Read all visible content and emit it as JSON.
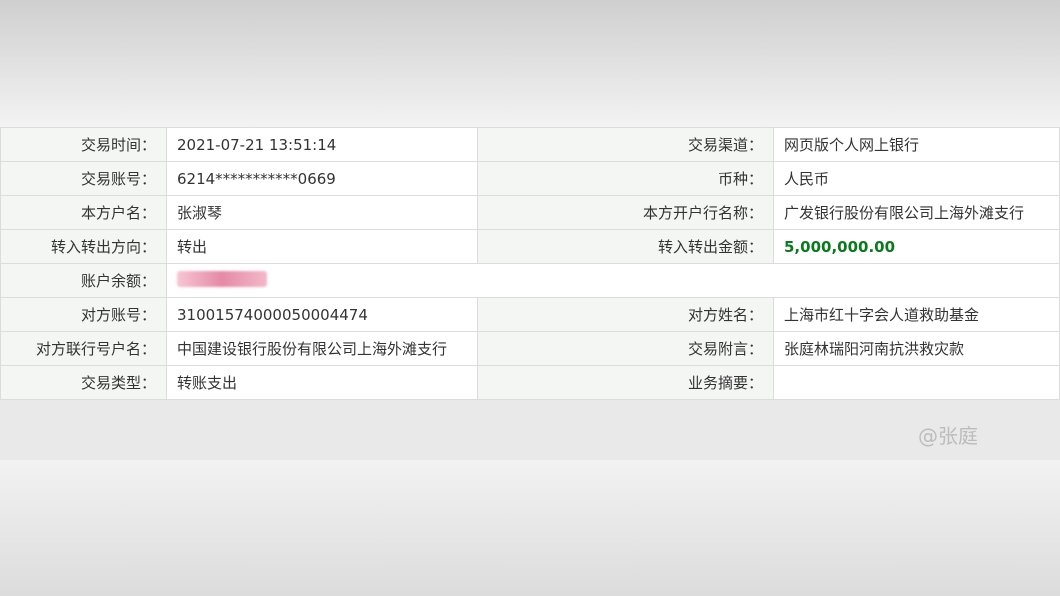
{
  "rows": [
    {
      "k1": "交易时间：",
      "v1": "2021-07-21 13:51:14",
      "k2": "交易渠道：",
      "v2": "网页版个人网上银行"
    },
    {
      "k1": "交易账号：",
      "v1": "6214***********0669",
      "k2": "币种：",
      "v2": "人民币"
    },
    {
      "k1": "本方户名：",
      "v1": "张淑琴",
      "k2": "本方开户行名称：",
      "v2": "广发银行股份有限公司上海外滩支行"
    },
    {
      "k1": "转入转出方向：",
      "v1": "转出",
      "k2": "转入转出金额：",
      "v2": "5,000,000.00"
    },
    {
      "k1": "账户余额：",
      "v1": "",
      "k2": "",
      "v2": ""
    },
    {
      "k1": "对方账号：",
      "v1": "31001574000050004474",
      "k2": "对方姓名：",
      "v2": "上海市红十字会人道救助基金"
    },
    {
      "k1": "对方联行号户名：",
      "v1": "中国建设银行股份有限公司上海外滩支行",
      "k2": "交易附言：",
      "v2": "张庭林瑞阳河南抗洪救灾款"
    },
    {
      "k1": "交易类型：",
      "v1": "转账支出",
      "k2": "业务摘要：",
      "v2": ""
    }
  ],
  "watermark": "@张庭",
  "amount_color": "#0a7a1d"
}
